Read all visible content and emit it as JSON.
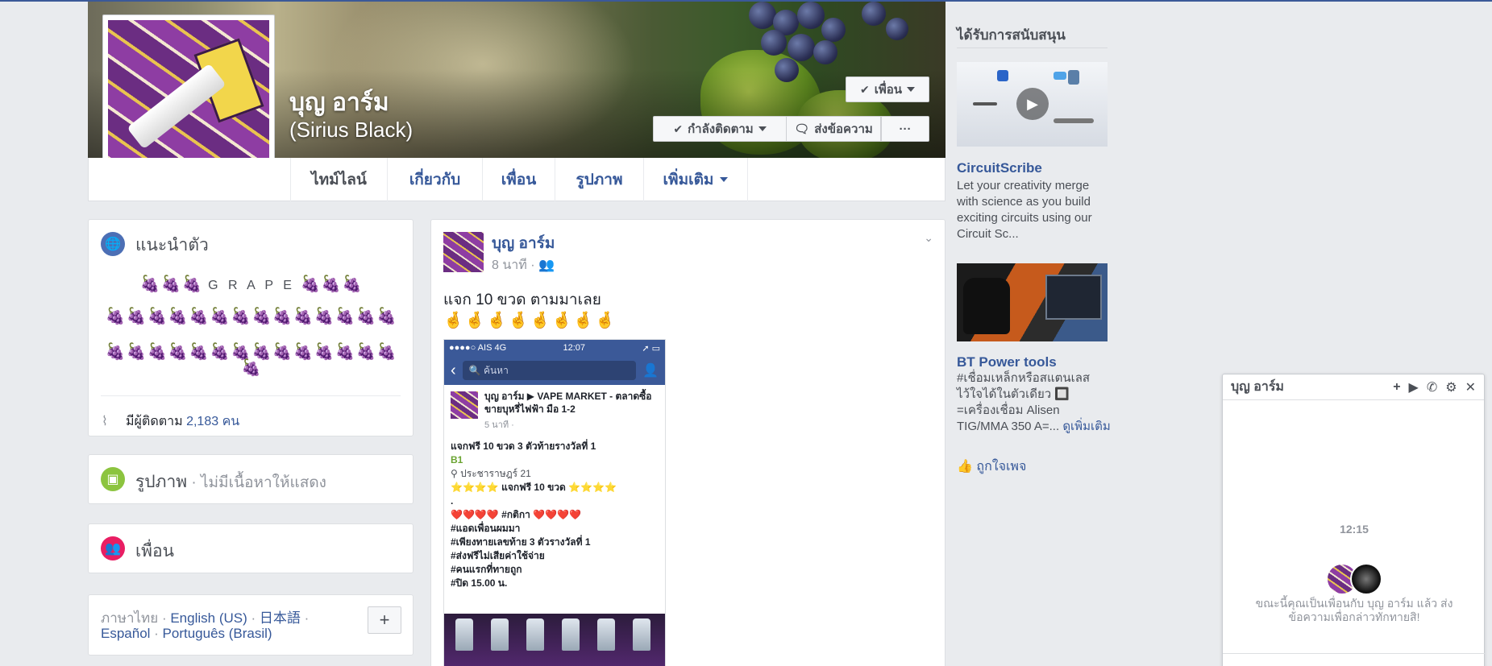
{
  "profile": {
    "name": "บุญ อาร์ม",
    "alternate_name": "(Sirius Black)"
  },
  "cover_actions": {
    "friends_label": "เพื่อน",
    "following_label": "กำลังติดตาม",
    "message_label": "ส่งข้อความ",
    "more_label": "···"
  },
  "nav": {
    "tabs": [
      {
        "label": "ไทม์ไลน์"
      },
      {
        "label": "เกี่ยวกับ"
      },
      {
        "label": "เพื่อน"
      },
      {
        "label": "รูปภาพ"
      },
      {
        "label": "เพิ่มเติม"
      }
    ]
  },
  "intro": {
    "title": "แนะนำตัว",
    "bio_line1": "🍇🍇🍇",
    "bio_word": "G R A P E",
    "bio_line1_end": "🍇🍇🍇",
    "bio_line2": "🍇🍇🍇🍇🍇🍇🍇🍇🍇🍇🍇🍇🍇🍇",
    "bio_line3": "🍇🍇🍇🍇🍇🍇🍇🍇🍇🍇🍇🍇🍇🍇",
    "bio_line4": "🍇",
    "followers_prefix": "มีผู้ติดตาม",
    "followers_count": "2,183 คน"
  },
  "photos_card": {
    "title": "รูปภาพ",
    "empty": " · ไม่มีเนื้อหาให้แสดง"
  },
  "friends_card": {
    "title": "เพื่อน"
  },
  "languages": {
    "current": "ภาษาไทย",
    "sep": " · ",
    "items": [
      "English (US)",
      "日本語",
      "Español",
      "Português (Brasil)"
    ],
    "add_label": "+"
  },
  "post": {
    "author": "บุญ อาร์ม",
    "time": "8 นาที ·",
    "text": "แจก 10 ขวด ตามมาเลย",
    "emojis": "🤞🤞🤞🤞🤞🤞🤞🤞",
    "screenshot": {
      "status_left": "●●●●○ AIS  4G",
      "status_time": "12:07",
      "status_right": "➚ ▭",
      "search_placeholder": "ค้นหา",
      "post_header": "บุญ อาร์ม ▶ VAPE MARKET - ตลาดซื้อขายบุหรี่ไฟฟ้า มือ 1-2",
      "post_sub": "5 นาที ·",
      "line1": "แจกฟรี 10 ขวด 3 ตัวท้ายรางวัลที่ 1",
      "line2": "B1",
      "line3": "ประชาราษฎร์ 21",
      "line4": "⭐⭐⭐⭐ แจกฟรี 10 ขวด ⭐⭐⭐⭐",
      "line5": ".",
      "line6": "❤️❤️❤️❤️ #กติกา ❤️❤️❤️❤️",
      "line7": "#แอดเพื่อนผมมา",
      "line8": "#เพียงทายเลขท้าย 3 ตัวรางวัลที่ 1",
      "line9": "#ส่งฟรีไม่เสียค่าใช้จ่าย",
      "line10": "#คนแรกที่ทายถูก",
      "line11": "#ปิด 15.00 น."
    }
  },
  "sidebar": {
    "sponsored_title": "ได้รับการสนับสนุน",
    "ads": [
      {
        "title": "CircuitScribe",
        "text": "Let your creativity merge with science as you build exciting circuits using our Circuit Sc..."
      },
      {
        "title": "BT Power tools",
        "text": "#เชื่อมเหล็กหรือสแตนเลส ไว้ใจได้ในตัวเดียว 🔲 =เครื่องเชื่อม Alisen TIG/MMA 350 A=...",
        "more": "ดูเพิ่มเติม"
      }
    ],
    "like_page": "ถูกใจเพจ"
  },
  "chat": {
    "name": "บุญ อาร์ม",
    "time": "12:15",
    "message": "ขณะนี้คุณเป็นเพื่อนกับ บุญ อาร์ม แล้ว ส่งข้อความเพื่อกล่าวทักทายสิ!"
  },
  "colors": {
    "fb_blue": "#3b5998",
    "link_blue": "#365899",
    "background": "#e9ebee"
  }
}
